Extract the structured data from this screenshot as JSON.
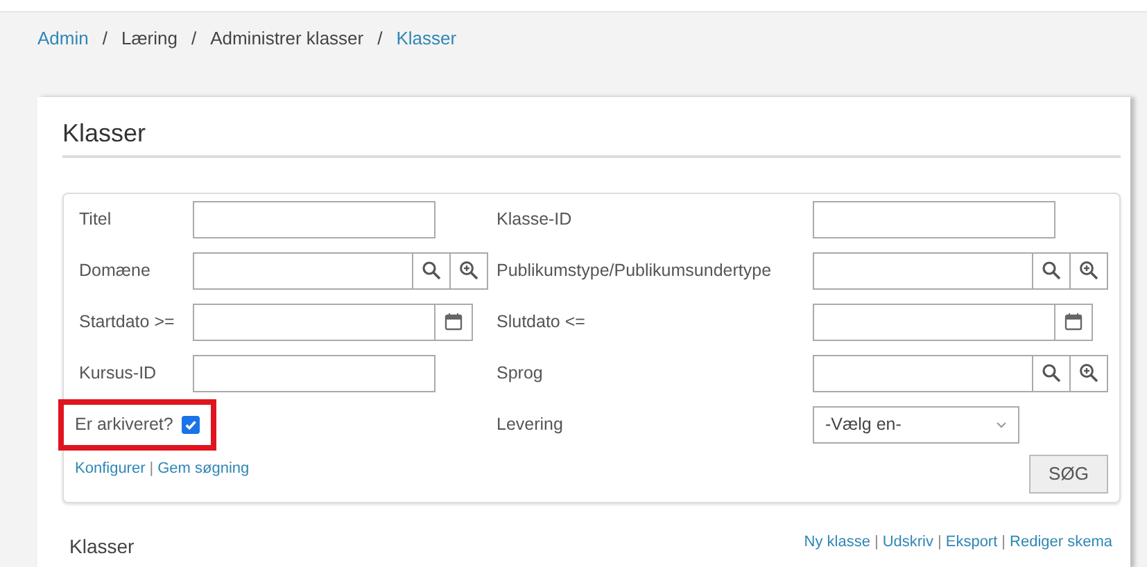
{
  "breadcrumb": [
    {
      "label": "Admin",
      "link": true
    },
    {
      "label": "Læring",
      "link": false
    },
    {
      "label": "Administrer klasser",
      "link": false
    },
    {
      "label": "Klasser",
      "link": true
    }
  ],
  "breadcrumb_separator": "/",
  "page_title": "Klasser",
  "filters": {
    "left": [
      {
        "label": "Titel",
        "kind": "text"
      },
      {
        "label": "Domæne",
        "kind": "lookup"
      },
      {
        "label": "Startdato >=",
        "kind": "date"
      },
      {
        "label": "Kursus-ID",
        "kind": "text"
      },
      {
        "label": "Er arkiveret?",
        "kind": "checkbox",
        "checked": true,
        "highlighted": true
      }
    ],
    "right": [
      {
        "label": "Klasse-ID",
        "kind": "text"
      },
      {
        "label": "Publikumstype/Publikumsundertype",
        "kind": "lookup"
      },
      {
        "label": "Slutdato <=",
        "kind": "date"
      },
      {
        "label": "Sprog",
        "kind": "lookup"
      },
      {
        "label": "Levering",
        "kind": "select",
        "value": "-Vælg en-"
      }
    ],
    "links": [
      "Konfigurer",
      "Gem søgning"
    ],
    "link_separator": "|",
    "search_button": "SØG"
  },
  "results": {
    "title": "Klasser",
    "actions": [
      "Ny klasse",
      "Udskriv",
      "Eksport",
      "Rediger skema"
    ],
    "action_separator": "|"
  }
}
